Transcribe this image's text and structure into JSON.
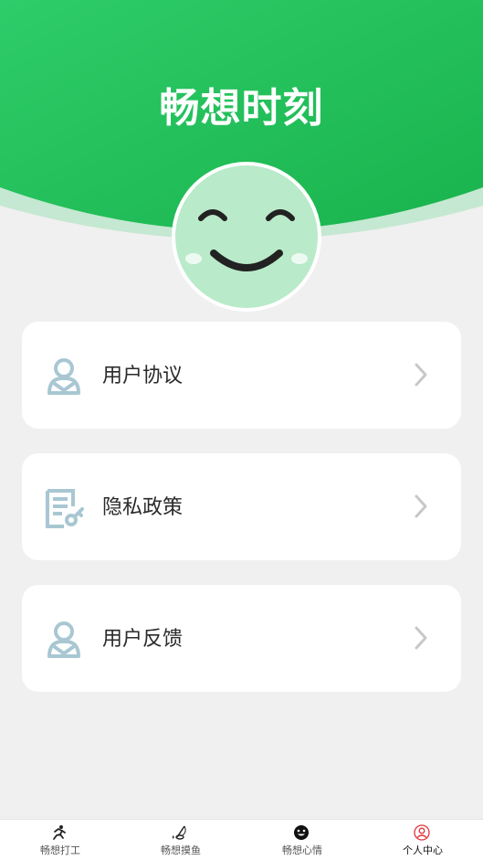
{
  "header": {
    "title": "畅想时刻"
  },
  "menu": [
    {
      "label": "用户协议",
      "icon": "user-icon"
    },
    {
      "label": "隐私政策",
      "icon": "privacy-document-key-icon"
    },
    {
      "label": "用户反馈",
      "icon": "user-icon"
    }
  ],
  "tabs": [
    {
      "label": "畅想打工",
      "icon": "runner-icon"
    },
    {
      "label": "畅想摸鱼",
      "icon": "fishing-icon"
    },
    {
      "label": "畅想心情",
      "icon": "smiley-icon"
    },
    {
      "label": "个人中心",
      "icon": "profile-icon",
      "active": true
    }
  ],
  "colors": {
    "brand_green": "#1db954",
    "icon_blue": "#a8c7d2",
    "active_red": "#e0333a"
  }
}
